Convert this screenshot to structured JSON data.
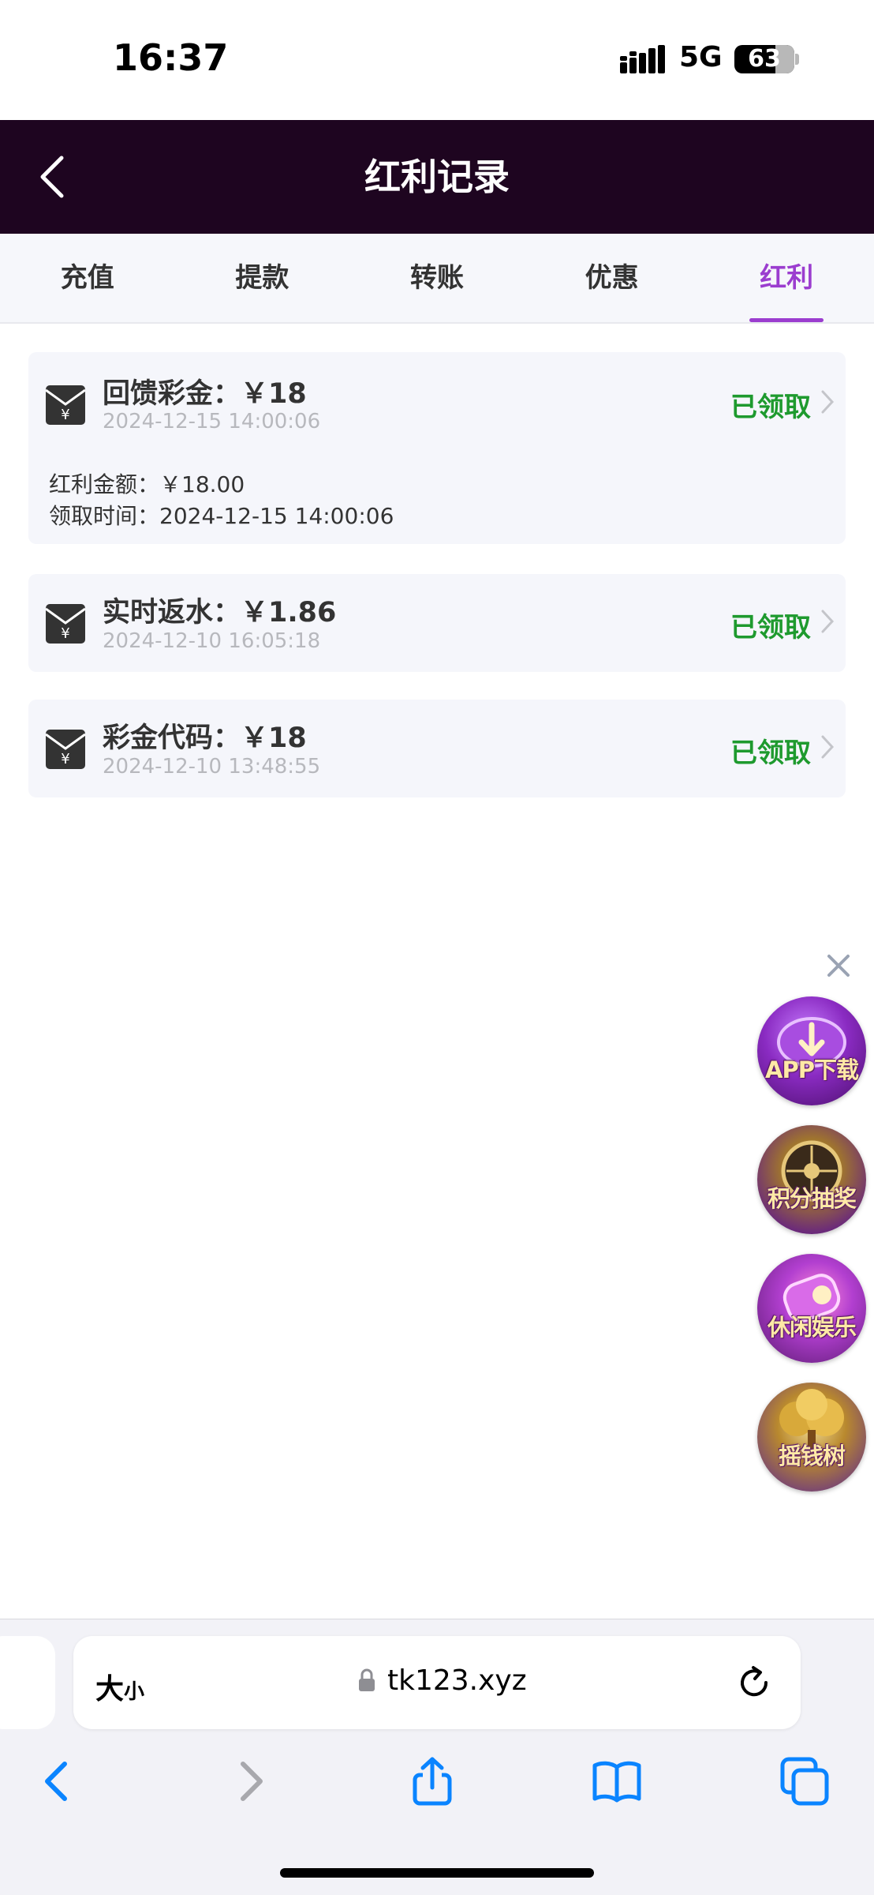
{
  "status_bar": {
    "time": "16:37",
    "network": "5G",
    "battery": "63"
  },
  "header": {
    "title": "红利记录"
  },
  "tabs": [
    {
      "label": "充值",
      "active": false
    },
    {
      "label": "提款",
      "active": false
    },
    {
      "label": "转账",
      "active": false
    },
    {
      "label": "优惠",
      "active": false
    },
    {
      "label": "红利",
      "active": true
    }
  ],
  "records": [
    {
      "title": "回馈彩金：￥18",
      "date": "2024-12-15 14:00:06",
      "status": "已领取",
      "expanded": true,
      "details": [
        "红利金额：￥18.00",
        "领取时间：2024-12-15 14:00:06"
      ]
    },
    {
      "title": "实时返水：￥1.86",
      "date": "2024-12-10 16:05:18",
      "status": "已领取",
      "expanded": false
    },
    {
      "title": "彩金代码：￥18",
      "date": "2024-12-10 13:48:55",
      "status": "已领取",
      "expanded": false
    }
  ],
  "floating": [
    {
      "label": "APP下载",
      "icon": "app-download-icon"
    },
    {
      "label": "积分抽奖",
      "icon": "lottery-wheel-icon"
    },
    {
      "label": "休闲娱乐",
      "icon": "leisure-game-icon"
    },
    {
      "label": "摇钱树",
      "icon": "money-tree-icon"
    }
  ],
  "browser": {
    "text_size": "大",
    "text_size_small": "小",
    "url": "tk123.xyz"
  },
  "colors": {
    "header_bg": "#1e0520",
    "accent": "#9b3dcf",
    "claimed": "#1e9a2e"
  }
}
